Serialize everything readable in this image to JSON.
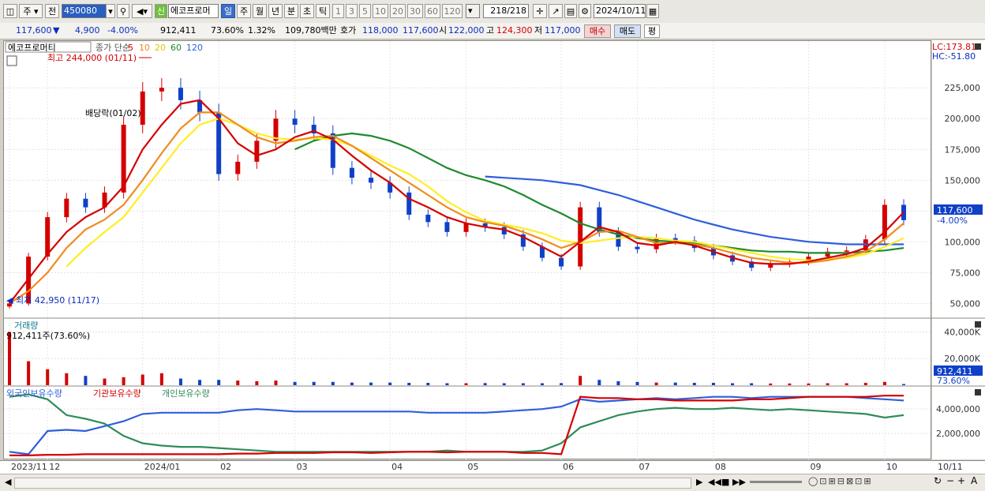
{
  "toolbar": {
    "market_label": "주",
    "prev_label": "전",
    "code_value": "450080",
    "new_badge": "신",
    "stock_name": "에코프로머",
    "periods": [
      "일",
      "주",
      "월",
      "년",
      "분",
      "초",
      "틱"
    ],
    "active_period": "일",
    "intervals": [
      "1",
      "3",
      "5",
      "10",
      "20",
      "30",
      "60",
      "120"
    ],
    "count": "218/218",
    "date": "2024/10/11"
  },
  "quote": {
    "price": "117,600",
    "change": "4,900",
    "change_pct": "-4.00%",
    "volume": "912,411",
    "vol_ratio": "73.60%",
    "turnover": "1.32%",
    "amount": "109,780백만",
    "hoga_label": "호가",
    "ask": "118,000",
    "bid": "117,600",
    "open_label": "시",
    "open": "122,000",
    "high_label": "고",
    "high": "124,300",
    "low_label": "저",
    "low": "117,000",
    "buy_label": "매수",
    "sell_label": "매도",
    "flat_label": "평"
  },
  "colors": {
    "up": "#d40000",
    "down": "#1040c8",
    "ma5": "#d40000",
    "ma10": "#f08c1e",
    "ma20": "#ffee22",
    "ma60": "#1f8a2e",
    "ma120": "#2e5fdc",
    "foreign": "#2e5fdc",
    "inst": "#d40000",
    "retail": "#2e8c5a"
  },
  "chart_data": [
    {
      "type": "candlestick",
      "title": "에코프로머티",
      "legend": {
        "prefix": "종가 단순",
        "periods": [
          "5",
          "10",
          "20",
          "60",
          "120"
        ]
      },
      "annotations": {
        "high": "최고 244,000 (01/11)",
        "low": "최저 42,950 (11/17)",
        "event": "배당락(01/02)"
      },
      "x_ticks": [
        "2023/11",
        "12",
        "2024/01",
        "02",
        "03",
        "04",
        "05",
        "06",
        "07",
        "08",
        "09",
        "10",
        "10/11"
      ],
      "y_ticks": [
        "225,000",
        "200,000",
        "175,000",
        "150,000",
        "125,000",
        "100,000",
        "75,000",
        "50,000"
      ],
      "ylim": [
        40000,
        245000
      ],
      "lc": "LC:173.81",
      "hc": "HC:-51.80",
      "last_price_tag": "117,600",
      "last_pct_tag": "-4.00%",
      "dates": [
        "2023-11-17",
        "2023-11-24",
        "2023-12-01",
        "2023-12-08",
        "2023-12-15",
        "2023-12-22",
        "2023-12-29",
        "2024-01-05",
        "2024-01-11",
        "2024-01-19",
        "2024-01-26",
        "2024-02-02",
        "2024-02-09",
        "2024-02-16",
        "2024-02-23",
        "2024-03-01",
        "2024-03-08",
        "2024-03-15",
        "2024-03-22",
        "2024-03-29",
        "2024-04-05",
        "2024-04-12",
        "2024-04-19",
        "2024-04-26",
        "2024-05-03",
        "2024-05-10",
        "2024-05-17",
        "2024-05-24",
        "2024-05-31",
        "2024-06-07",
        "2024-06-14",
        "2024-06-21",
        "2024-06-28",
        "2024-07-05",
        "2024-07-12",
        "2024-07-19",
        "2024-07-26",
        "2024-08-02",
        "2024-08-09",
        "2024-08-16",
        "2024-08-23",
        "2024-08-30",
        "2024-09-06",
        "2024-09-13",
        "2024-09-20",
        "2024-09-27",
        "2024-10-04",
        "2024-10-11"
      ],
      "close": [
        50000,
        88000,
        120000,
        135000,
        128000,
        140000,
        195000,
        222000,
        225000,
        215000,
        205000,
        155000,
        165000,
        182000,
        200000,
        195000,
        188000,
        160000,
        152000,
        148000,
        140000,
        122000,
        116000,
        108000,
        115000,
        112000,
        106000,
        96000,
        87000,
        80000,
        128000,
        108000,
        96000,
        94000,
        103000,
        101000,
        95000,
        89000,
        84000,
        79000,
        82000,
        84000,
        88000,
        92000,
        93000,
        102000,
        130000,
        117600
      ],
      "ma5": [
        50000,
        70000,
        90000,
        108000,
        120000,
        128000,
        145000,
        175000,
        195000,
        212000,
        215000,
        200000,
        180000,
        170000,
        175000,
        185000,
        190000,
        183000,
        170000,
        158000,
        148000,
        135000,
        128000,
        120000,
        115000,
        112000,
        110000,
        104000,
        96000,
        88000,
        100000,
        112000,
        108000,
        99000,
        97000,
        100000,
        97000,
        92000,
        87000,
        83000,
        82000,
        82000,
        84000,
        87000,
        90000,
        95000,
        108000,
        124000
      ],
      "ma10": [
        50000,
        60000,
        75000,
        95000,
        110000,
        118000,
        130000,
        150000,
        172000,
        192000,
        205000,
        205000,
        195000,
        185000,
        180000,
        182000,
        185000,
        186000,
        178000,
        168000,
        158000,
        148000,
        138000,
        128000,
        120000,
        116000,
        113000,
        108000,
        102000,
        95000,
        100000,
        108000,
        109000,
        104000,
        99000,
        99000,
        98000,
        95000,
        91000,
        87000,
        85000,
        83000,
        83000,
        85000,
        88000,
        92000,
        102000,
        115000
      ],
      "ma20": [
        null,
        null,
        null,
        80000,
        95000,
        108000,
        120000,
        140000,
        160000,
        180000,
        195000,
        200000,
        195000,
        188000,
        184000,
        183000,
        184000,
        183000,
        178000,
        170000,
        162000,
        155000,
        145000,
        133000,
        124000,
        117000,
        114000,
        111000,
        107000,
        101000,
        99000,
        101000,
        103000,
        104000,
        103000,
        101000,
        100000,
        97000,
        94000,
        91000,
        88000,
        86000,
        85000,
        86000,
        87000,
        90000,
        96000,
        103000
      ],
      "ma60": [
        null,
        null,
        null,
        null,
        null,
        null,
        null,
        null,
        null,
        null,
        null,
        null,
        null,
        null,
        null,
        175000,
        182000,
        186000,
        188000,
        186000,
        182000,
        176000,
        168000,
        160000,
        154000,
        150000,
        145000,
        138000,
        130000,
        123000,
        115000,
        110000,
        106000,
        103000,
        101000,
        100000,
        99000,
        97000,
        95000,
        93000,
        92000,
        92000,
        91000,
        91000,
        91000,
        92000,
        93000,
        95000
      ],
      "ma120": [
        null,
        null,
        null,
        null,
        null,
        null,
        null,
        null,
        null,
        null,
        null,
        null,
        null,
        null,
        null,
        null,
        null,
        null,
        null,
        null,
        null,
        null,
        null,
        null,
        null,
        153000,
        152000,
        151000,
        150000,
        148000,
        146000,
        142000,
        138000,
        133000,
        128000,
        123000,
        118000,
        114000,
        110000,
        107000,
        104000,
        102000,
        100000,
        99000,
        98000,
        98000,
        98000,
        98000
      ]
    },
    {
      "type": "bar",
      "title": "거래량",
      "subtitle": "912,411주(73.60%)",
      "y_ticks": [
        "40,000K",
        "20,000K"
      ],
      "ylim": [
        0,
        45000
      ],
      "last_tag": "912,411",
      "last_pct": "73.60%",
      "values_k": [
        40000,
        18000,
        12000,
        9000,
        7000,
        5000,
        6000,
        8000,
        9000,
        5000,
        4000,
        4000,
        3500,
        3000,
        3500,
        2500,
        2500,
        2500,
        2000,
        2000,
        2000,
        1800,
        1800,
        1500,
        1500,
        1600,
        1500,
        1500,
        1500,
        1600,
        7000,
        4000,
        3000,
        2500,
        2000,
        2000,
        1800,
        1800,
        1500,
        1500,
        1300,
        1300,
        1300,
        1500,
        1500,
        1800,
        2500,
        912
      ]
    },
    {
      "type": "line",
      "title": "외국인보유수량",
      "series_names": [
        "외국인보유수량",
        "기관보유수량",
        "개인보유수량"
      ],
      "y_ticks": [
        "4,000,000",
        "2,000,000"
      ],
      "ylim": [
        0,
        5500000
      ],
      "foreign": [
        500000,
        300000,
        2200000,
        2300000,
        2200000,
        2600000,
        3000000,
        3600000,
        3700000,
        3700000,
        3700000,
        3700000,
        3900000,
        4000000,
        3900000,
        3800000,
        3800000,
        3800000,
        3800000,
        3800000,
        3800000,
        3800000,
        3700000,
        3700000,
        3700000,
        3700000,
        3800000,
        3900000,
        4000000,
        4200000,
        4800000,
        4600000,
        4700000,
        4800000,
        4900000,
        4800000,
        4900000,
        5000000,
        5000000,
        4900000,
        5000000,
        5000000,
        5000000,
        5000000,
        5000000,
        4900000,
        4800000,
        4700000
      ],
      "inst": [
        200000,
        200000,
        250000,
        250000,
        300000,
        300000,
        300000,
        300000,
        300000,
        300000,
        300000,
        300000,
        350000,
        350000,
        400000,
        400000,
        400000,
        450000,
        450000,
        400000,
        450000,
        500000,
        500000,
        450000,
        500000,
        500000,
        500000,
        400000,
        400000,
        300000,
        5000000,
        4900000,
        4900000,
        4800000,
        4800000,
        4700000,
        4700000,
        4700000,
        4700000,
        4800000,
        4800000,
        4900000,
        5000000,
        5000000,
        5000000,
        5000000,
        5100000,
        5100000
      ],
      "retail": [
        5000000,
        5200000,
        4800000,
        3500000,
        3200000,
        2800000,
        1800000,
        1200000,
        1000000,
        900000,
        900000,
        800000,
        700000,
        600000,
        500000,
        500000,
        500000,
        500000,
        500000,
        500000,
        500000,
        500000,
        500000,
        600000,
        500000,
        500000,
        500000,
        500000,
        600000,
        1200000,
        2500000,
        3000000,
        3500000,
        3800000,
        4000000,
        4100000,
        4000000,
        4000000,
        4100000,
        4000000,
        3900000,
        4000000,
        3900000,
        3800000,
        3700000,
        3600000,
        3300000,
        3500000
      ]
    }
  ],
  "scroll": {
    "icons": [
      "left-arrow",
      "right-arrow",
      "rewind",
      "stop",
      "fast-forward"
    ]
  }
}
